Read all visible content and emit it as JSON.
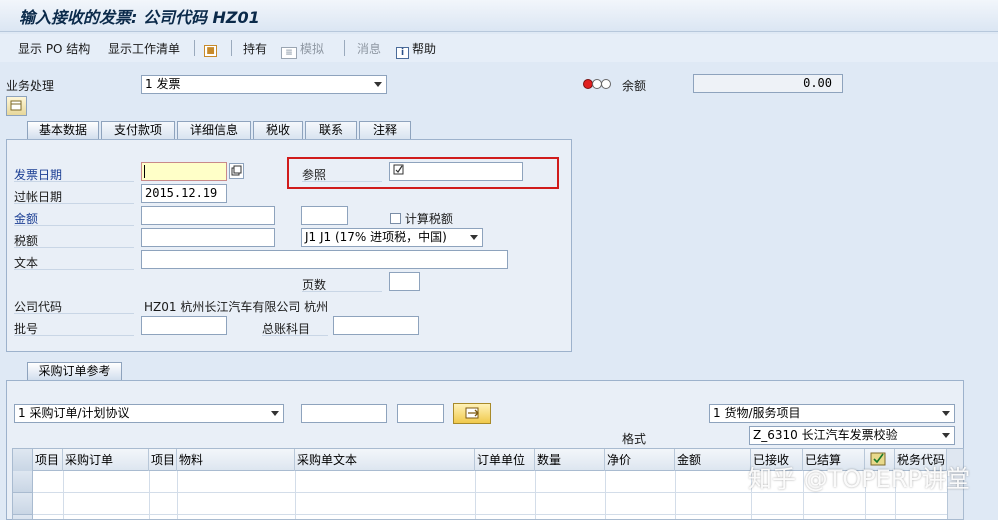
{
  "window": {
    "title": "输入接收的发票: 公司代码 HZ01"
  },
  "toolbar": {
    "show_po_structure": "显示 PO 结构",
    "show_worklist": "显示工作清单",
    "hold": "持有",
    "simulate": "模拟",
    "messages": "消息",
    "help": "帮助"
  },
  "header": {
    "transaction_label": "业务处理",
    "transaction_value": "1 发票",
    "balance_label": "余额",
    "balance_value": "0.00"
  },
  "tabs": [
    "基本数据",
    "支付款项",
    "详细信息",
    "税收",
    "联系",
    "注释"
  ],
  "basic_data": {
    "invoice_date_label": "发票日期",
    "invoice_date_value": "",
    "reference_label": "参照",
    "reference_value": "",
    "posting_date_label": "过帐日期",
    "posting_date_value": "2015.12.19",
    "amount_label": "金额",
    "amount_value": "",
    "currency_value": "",
    "calc_tax_label": "计算税额",
    "tax_label": "税额",
    "tax_value": "",
    "tax_code_value": "J1 J1 (17% 进项税，中国)",
    "text_label": "文本",
    "text_value": "",
    "pages_label": "页数",
    "pages_value": "",
    "company_code_label": "公司代码",
    "company_code_value": "HZ01 杭州长江汽车有限公司 杭州",
    "batch_label": "批号",
    "batch_value": "",
    "gl_account_label": "总账科目",
    "gl_account_value": ""
  },
  "po_reference": {
    "tab_label": "采购订单参考",
    "ref_type_value": "1 采购订单/计划协议",
    "po_number_value": "",
    "po_item_value": "",
    "item_type_value": "1 货物/服务项目",
    "layout_label": "格式",
    "layout_value": "Z_6310 长江汽车发票校验",
    "columns": [
      "项目",
      "采购订单",
      "项目",
      "物料",
      "采购单文本",
      "订单单位",
      "数量",
      "净价",
      "金额",
      "已接收",
      "已结算",
      "",
      "税务代码"
    ]
  },
  "watermark": "知乎 @TOPERP讲堂",
  "colors": {
    "highlight_border": "#d01b1b",
    "required_field": "#ffffc8",
    "label_blue": "#1c3f94"
  }
}
